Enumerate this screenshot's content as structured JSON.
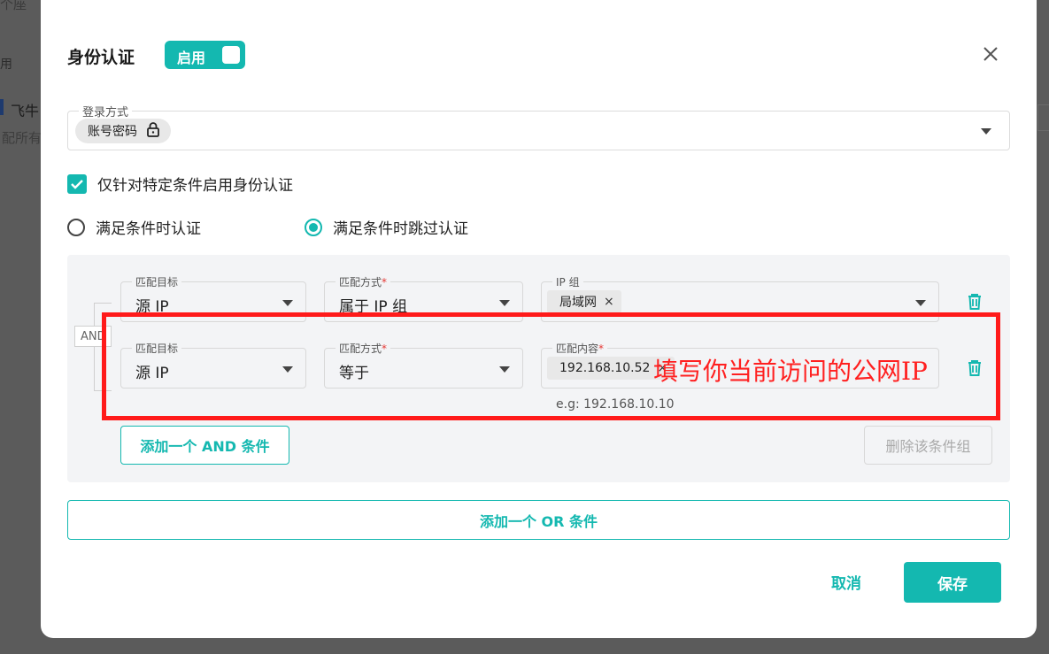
{
  "background": {
    "text_top": "个座",
    "col_label": "用",
    "row_name": "飞牛",
    "row_sub": "配所有"
  },
  "modal": {
    "title": "身份认证",
    "toggle_label": "启用",
    "toggle_on": true,
    "close_icon": "close-icon"
  },
  "login": {
    "legend": "登录方式",
    "chip_label": "账号密码",
    "chip_icon": "lock-icon"
  },
  "options": {
    "checkbox_label": "仅针对特定条件启用身份认证",
    "checkbox_checked": true,
    "radio_1": "满足条件时认证",
    "radio_2": "满足条件时跳过认证",
    "selected_radio": 2
  },
  "group": {
    "and_label": "AND",
    "rows": [
      {
        "target_legend": "匹配目标",
        "target_value": "源 IP",
        "method_legend": "匹配方式",
        "method_required": "*",
        "method_value": "属于 IP 组",
        "value_legend": "IP 组",
        "tag": "局域网",
        "tag_remove": "×"
      },
      {
        "target_legend": "匹配目标",
        "target_value": "源 IP",
        "method_legend": "匹配方式",
        "method_required": "*",
        "method_value": "等于",
        "value_legend": "匹配内容",
        "value_required": "*",
        "tag": "192.168.10.52",
        "tag_remove": "×",
        "hint": "e.g: 192.168.10.10"
      }
    ],
    "add_and": "添加一个 AND 条件",
    "delete_group": "删除该条件组"
  },
  "add_or": "添加一个 OR 条件",
  "footer": {
    "cancel": "取消",
    "save": "保存"
  },
  "annotation": {
    "text": "填写你当前访问的公网IP",
    "color": "#ff1a1a"
  },
  "colors": {
    "accent": "#14b8b0",
    "danger": "#e53935"
  }
}
